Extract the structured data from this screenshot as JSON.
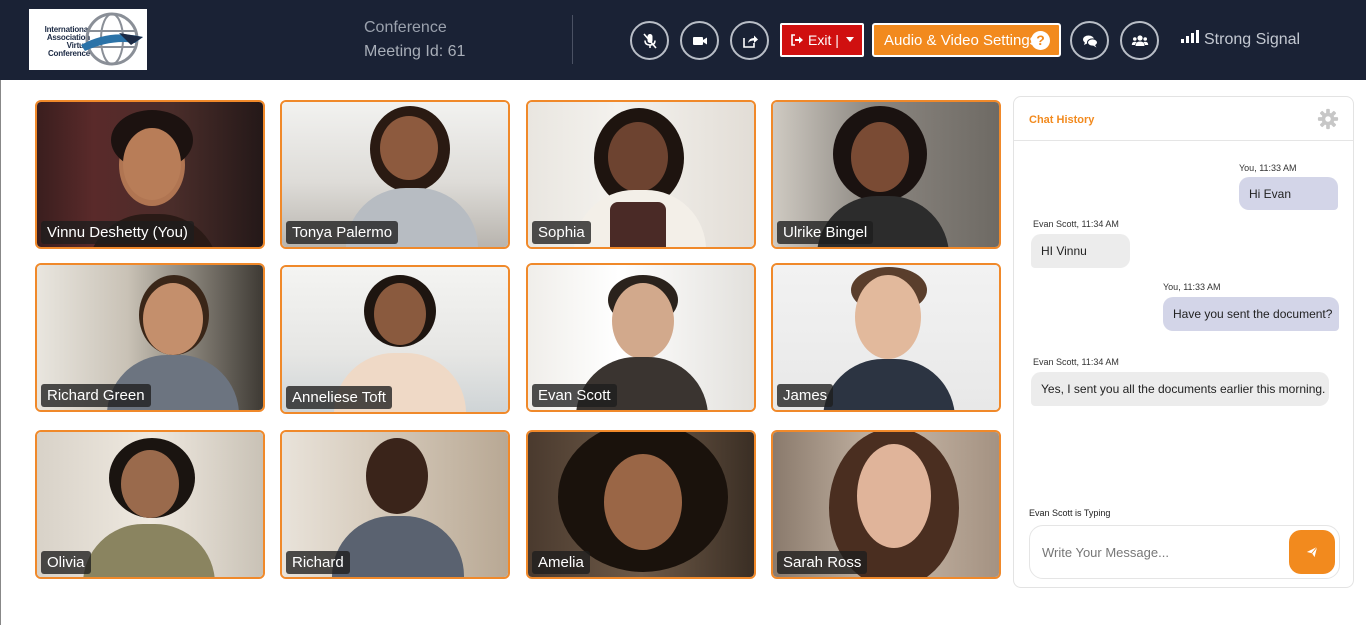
{
  "logo": {
    "line1": "International",
    "line2": "Association",
    "line3": "Virtual",
    "line4": "Conference"
  },
  "meeting": {
    "title": "Conference",
    "id_label": "Meeting Id: 61"
  },
  "toolbar": {
    "mic_icon": "mic-off-icon",
    "video_icon": "video-camera-icon",
    "share_icon": "share-screen-icon",
    "exit_label": "Exit |",
    "av_settings_label": "Audio & Video Settings",
    "chat_icon": "chat-bubbles-icon",
    "participants_icon": "participants-icon",
    "signal_label": "Strong Signal",
    "exit_color": "#d01010",
    "accent_color": "#f28a1e"
  },
  "participants": [
    {
      "name": "Vinnu Deshetty (You)"
    },
    {
      "name": "Tonya Palermo"
    },
    {
      "name": "Sophia"
    },
    {
      "name": "Ulrike Bingel"
    },
    {
      "name": "Richard Green"
    },
    {
      "name": "Anneliese Toft"
    },
    {
      "name": "Evan Scott"
    },
    {
      "name": "James"
    },
    {
      "name": "Olivia"
    },
    {
      "name": "Richard"
    },
    {
      "name": "Amelia"
    },
    {
      "name": "Sarah Ross"
    }
  ],
  "chat": {
    "title": "Chat History",
    "messages": [
      {
        "meta": "You, 11:33 AM",
        "text": "Hi Evan"
      },
      {
        "meta": "Evan Scott, 11:34 AM",
        "text": "HI Vinnu"
      },
      {
        "meta": "You, 11:33 AM",
        "text": "Have you sent the document?"
      },
      {
        "meta": "Evan Scott, 11:34 AM",
        "text": "Yes, I sent you all the documents earlier this morning."
      }
    ],
    "typing": "Evan Scott is Typing",
    "placeholder": "Write Your Message..."
  }
}
